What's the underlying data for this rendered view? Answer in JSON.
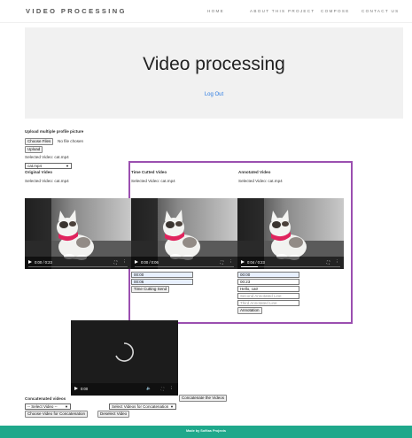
{
  "brand": "VIDEO PROCESSING",
  "nav": [
    "HOME",
    "ABOUT THIS PROJECT",
    "COMPOSE",
    "CONTACT US"
  ],
  "hero": {
    "title": "Video processing",
    "logout": "Log Out"
  },
  "upload": {
    "heading": "Upload multiple profile picture",
    "choose_files": "Choose Files",
    "no_file": "No file chosen",
    "upload_button": "Upload",
    "selected_text": "Selected Video: cat.mp4",
    "select_value": "cat.mp4"
  },
  "original": {
    "label": "Original Video",
    "selected": "Selected Video: cat.mp4",
    "time": "0:00 / 0:23",
    "progress": 0.0
  },
  "time_cutted": {
    "label": "Time Cutted Video",
    "selected": "Selected Video: cat.mp4",
    "time": "0:00 / 0:06",
    "progress": 0.0,
    "start_value": "00:00",
    "end_value": "00:06",
    "send_button": "Time Cutting Send"
  },
  "annotated": {
    "label": "Annotated Video",
    "selected": "Selected Video: cat.mp4",
    "time": "0:04 / 0:23",
    "progress": 0.17,
    "start_value": "00:00",
    "end_value": "00:23",
    "line1_value": "Hello, cat!",
    "line2_placeholder": "Second Annotated Line",
    "line3_placeholder": "Third Annotated Line",
    "button": "Annotation"
  },
  "concat": {
    "video_time": "0:00",
    "label": "Concatenated videos",
    "concatenate_button": "Concatenate the Videos",
    "select_video": "-- Select Video --",
    "select_for_concat": "Select Videos for Concatenation",
    "choose_button": "Choose Video for Concatenation",
    "deselect_button": "Deselect Video"
  },
  "footer": "Made by Sofitas Projects",
  "colors": {
    "accent_border": "#9b4fb0",
    "footer": "#1fa88b",
    "link": "#2a7ae2"
  },
  "icons": {
    "play": "play-icon",
    "fullscreen": "fullscreen-icon",
    "more": "more-options-icon",
    "volume": "volume-icon",
    "spinner": "loading-spinner-icon"
  }
}
